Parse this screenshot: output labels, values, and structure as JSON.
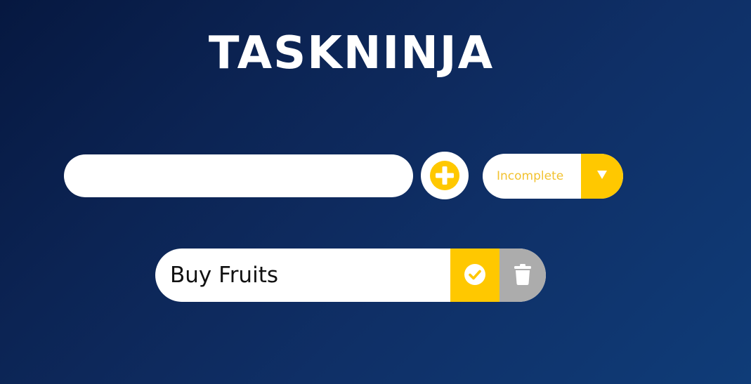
{
  "app": {
    "title": "TASKNINJA"
  },
  "form": {
    "input_value": "",
    "input_placeholder": "",
    "add_icon": "plus-circle-icon",
    "filter_selected": "Incomplete",
    "filter_icon": "triangle-down-icon"
  },
  "todos": [
    {
      "text": "Buy Fruits",
      "complete_icon": "check-circle-icon",
      "delete_icon": "trash-icon"
    }
  ],
  "colors": {
    "accent": "#ffc800",
    "filter_text": "#f2c230",
    "trash_bg": "#acacac",
    "background_start": "#061840",
    "background_end": "#0f3c78"
  }
}
